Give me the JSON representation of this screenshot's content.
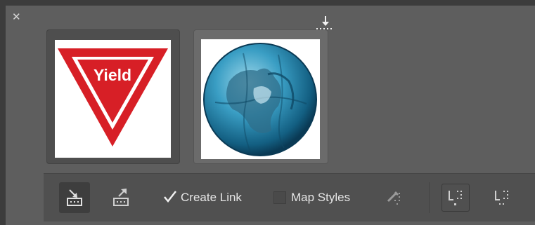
{
  "panel": {
    "close_icon": "close-icon",
    "drop_marker_icon": "insert-position-icon"
  },
  "thumbnails": [
    {
      "name": "yield-sign",
      "selected": true,
      "sign_text": "Yield"
    },
    {
      "name": "globe",
      "selected": false
    }
  ],
  "toolbar": {
    "create_link": {
      "label": "Create Link",
      "checked": true
    },
    "map_styles": {
      "label": "Map Styles",
      "checked": false
    },
    "buttons": [
      "place-content-icon",
      "place-and-link-icon",
      "edit-link-icon",
      "frame-fit-icon",
      "frame-fill-icon"
    ]
  },
  "colors": {
    "yield_red": "#d71f26",
    "globe_blue": "#1e7fa6",
    "panel_bg": "#5e5e5e",
    "toolbar_bg": "#505050"
  }
}
